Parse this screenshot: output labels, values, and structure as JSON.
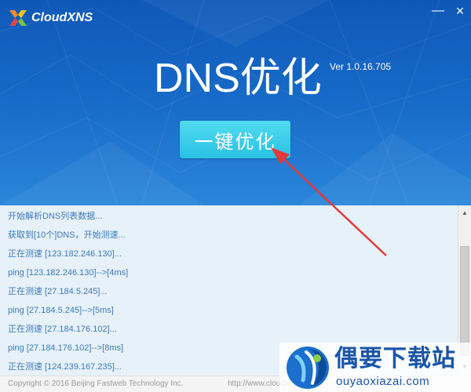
{
  "app": {
    "logo_text": "CloudXNS",
    "title": "DNS优化",
    "version": "Ver 1.0.16.705",
    "minimize_label": "—",
    "close_label": "×"
  },
  "main": {
    "optimize_button": "一键优化"
  },
  "log": {
    "lines": [
      "开始解析DNS列表数据...",
      "获取到[10个]DNS，开始测速...",
      "正在测速 [123.182.246.130]...",
      "ping [123.182.246.130]-->[4ms]",
      "正在测速 [27.184.5.245]...",
      "ping [27.184.5.245]-->[5ms]",
      "正在测速 [27.184.176.102]...",
      "ping [27.184.176.102]-->[8ms]",
      "正在测速 [124.239.167.235]..."
    ]
  },
  "scrollbar": {
    "up_icon": "▲",
    "down_icon": "▼"
  },
  "footer": {
    "copyright": "Copyright © 2016 Beijing Fastweb Technology Inc.",
    "website": "http://www.cloudxns.net"
  },
  "watermark": {
    "title": "偶要下载站",
    "url": "ouyaoxiazai.com"
  },
  "colors": {
    "header_top": "#0f58b8",
    "header_bottom": "#2b86da",
    "button": "#29c1e4",
    "log_text": "#3c7bbf",
    "log_bg": "#e7f1fa",
    "arrow": "#e23a3a",
    "watermark_text": "#1a55a8"
  }
}
